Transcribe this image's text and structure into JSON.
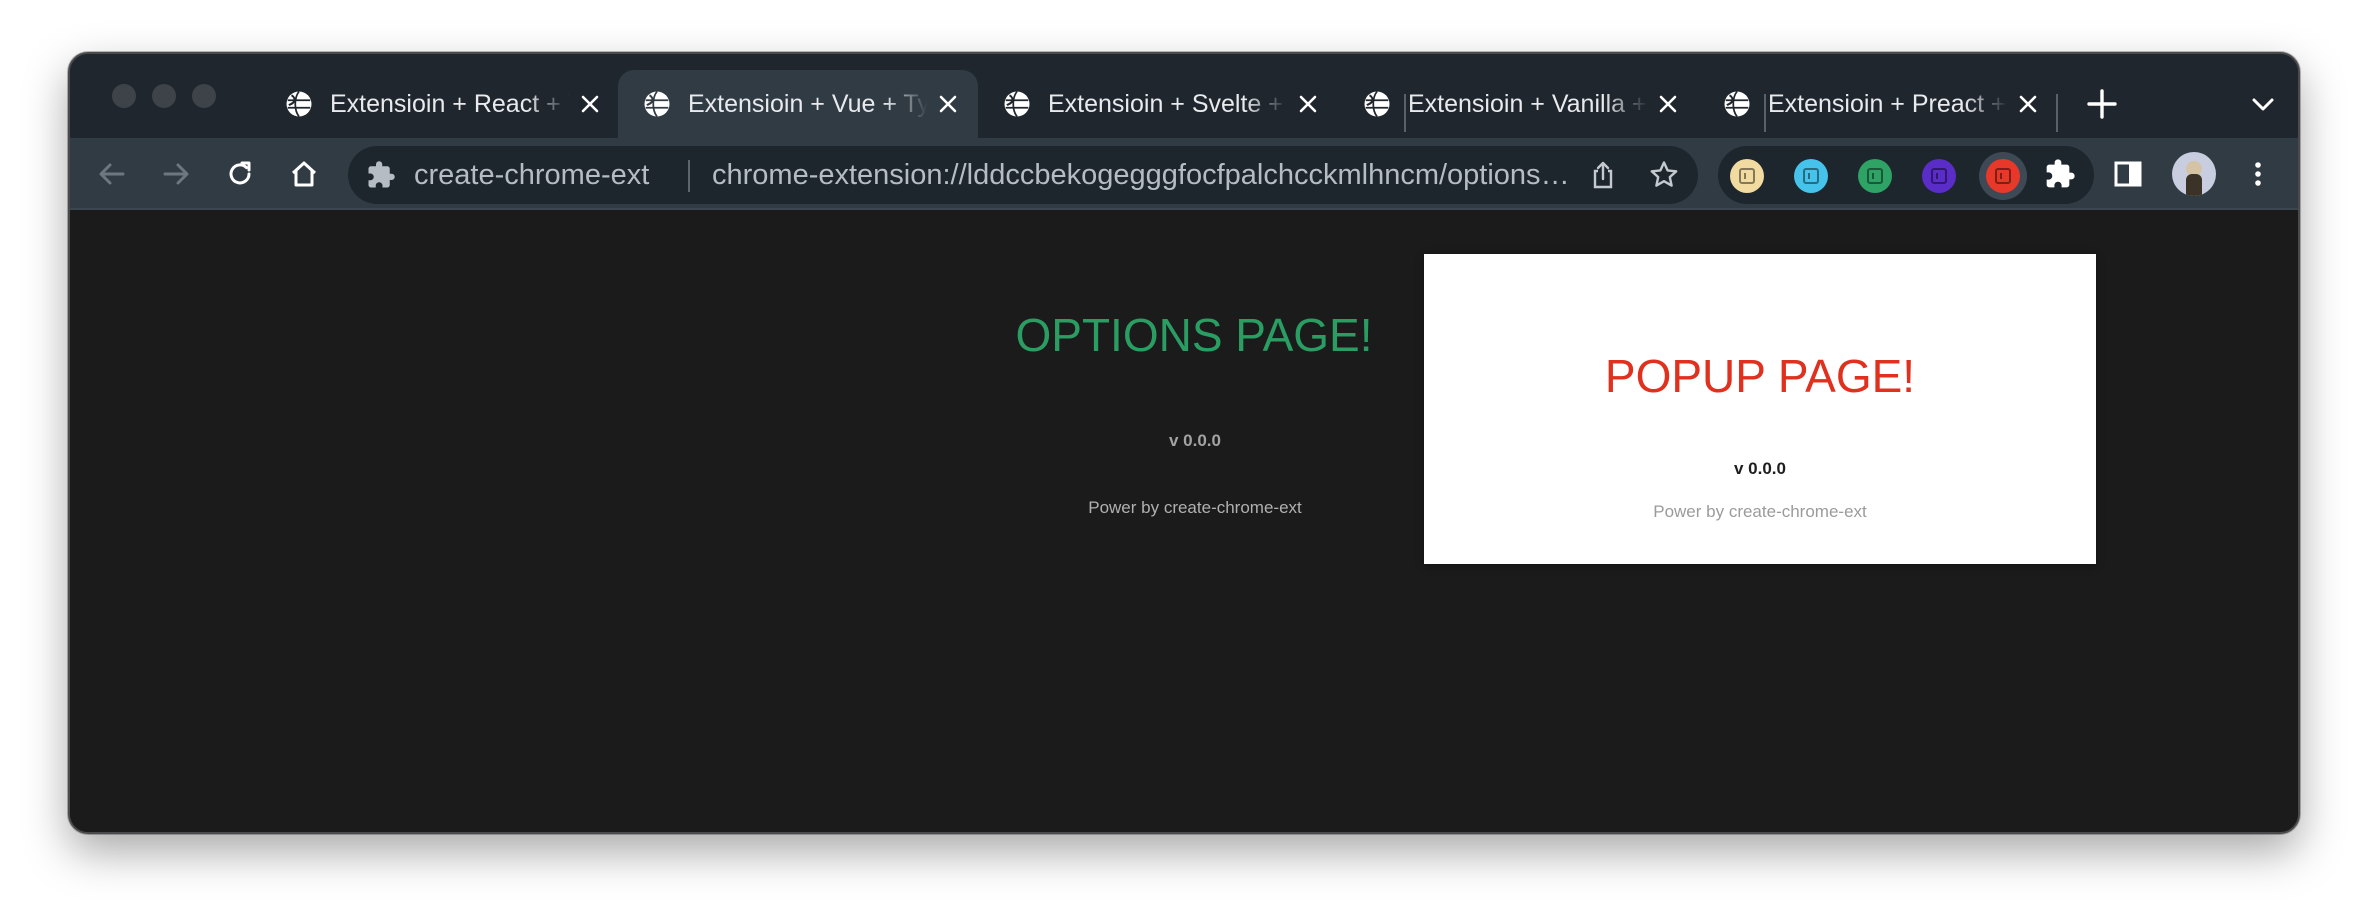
{
  "tabs": [
    {
      "title": "Extensioin + React + TypeScript"
    },
    {
      "title": "Extensioin + Vue + TypeScript"
    },
    {
      "title": "Extensioin + Svelte + TypeScript"
    },
    {
      "title": "Extensioin + Vanilla + TypeScript"
    },
    {
      "title": "Extensioin + Preact + TypeScript"
    }
  ],
  "active_tab_index": 1,
  "omnibox": {
    "extension_name": "create-chrome-ext",
    "url": "chrome-extension://lddccbekogegggfocfpalchcckmlhncm/options.html"
  },
  "extensions": [
    {
      "name": "react-ext-icon",
      "color": "#f2dba0"
    },
    {
      "name": "typescript-ext-icon",
      "color": "#46c3ea"
    },
    {
      "name": "vue-ext-icon",
      "color": "#2fa266"
    },
    {
      "name": "vite-ext-icon",
      "color": "#5a2dc9"
    },
    {
      "name": "svelte-ext-icon",
      "color": "#e8382a"
    }
  ],
  "options_page": {
    "title": "OPTIONS PAGE!",
    "version": "v 0.0.0",
    "power": "Power by create-chrome-ext",
    "title_color": "#2a9d62"
  },
  "popup": {
    "title": "POPUP PAGE!",
    "version": "v 0.0.0",
    "power": "Power by create-chrome-ext",
    "title_color": "#e0301e"
  }
}
